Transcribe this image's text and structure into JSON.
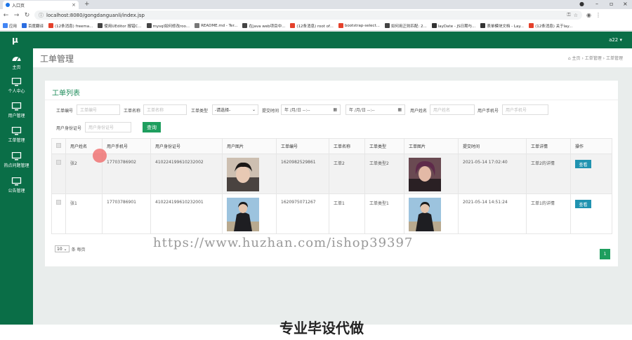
{
  "browser": {
    "tab_title": "入口页",
    "url": "localhost:8080/gongdanguanli/index.jsp",
    "bookmarks": [
      {
        "label": "应用",
        "color": "#4285f4"
      },
      {
        "label": "百度翻译",
        "color": "#2b6de0"
      },
      {
        "label": "(12条消息) freema...",
        "color": "#e4412b"
      },
      {
        "label": "使用UEditor 报错C...",
        "color": "#444444"
      },
      {
        "label": "mysql如何修改roo...",
        "color": "#444444"
      },
      {
        "label": "README.md - Ter...",
        "color": "#777777"
      },
      {
        "label": "在java web项目中...",
        "color": "#444444"
      },
      {
        "label": "(12条消息) root of...",
        "color": "#e4412b"
      },
      {
        "label": "bootstrap-select...",
        "color": "#e4412b"
      },
      {
        "label": "如何用正则匹配: 2...",
        "color": "#444444"
      },
      {
        "label": "layDate - JS日期与...",
        "color": "#333333"
      },
      {
        "label": "表单模块文档 - Lay...",
        "color": "#333333"
      },
      {
        "label": "(12条消息) 关于lay...",
        "color": "#e4412b"
      }
    ]
  },
  "app": {
    "logo": "μ",
    "user": "a22 ▾"
  },
  "sidebar": {
    "items": [
      {
        "label": "主页"
      },
      {
        "label": "个人中心"
      },
      {
        "label": "用户管理"
      },
      {
        "label": "工单管理"
      },
      {
        "label": "热点问题管理"
      },
      {
        "label": "公告管理"
      }
    ]
  },
  "page": {
    "title": "工单管理",
    "breadcrumb": "⌂ 主页 › 工单管理 › 工单管理"
  },
  "panel": {
    "title": "工单列表",
    "filters": {
      "order_no_label": "工单编号",
      "order_no_placeholder": "工单编号",
      "order_name_label": "工单名称",
      "order_name_placeholder": "工单名称",
      "order_type_label": "工单类型",
      "order_type_value": "-请选择-",
      "submit_time_label": "提交时间",
      "date_placeholder": "年 /月/日  --:--",
      "username_label": "用户姓名",
      "username_placeholder": "用户姓名",
      "phone_label": "用户手机号",
      "phone_placeholder": "用户手机号",
      "idcard_label": "用户身份证号",
      "idcard_placeholder": "用户身份证号",
      "search_button": "查询"
    },
    "table": {
      "headers": [
        "用户姓名",
        "用户手机号",
        "用户身份证号",
        "用户图片",
        "工单编号",
        "工单名称",
        "工单类型",
        "工单图片",
        "提交时间",
        "工单详情",
        "操作"
      ],
      "rows": [
        {
          "name": "张2",
          "phone": "17703786902",
          "idcard": "410224199610232002",
          "order_no": "1620982529861",
          "order_name": "工单2",
          "order_type": "工单类型2",
          "submit_time": "2021-05-14 17:02:40",
          "detail": "工单2的详情",
          "action": "查看"
        },
        {
          "name": "张1",
          "phone": "17703786901",
          "idcard": "410224199610232001",
          "order_no": "1620975071267",
          "order_name": "工单1",
          "order_type": "工单类型1",
          "submit_time": "2021-05-14 14:51:24",
          "detail": "工单1的详情",
          "action": "查看"
        }
      ]
    },
    "pagination": {
      "page_size": "10",
      "per_page_label": "条 每页",
      "current_page": "1"
    }
  },
  "overlay": {
    "watermark": "https://www.huzhan.com/ishop39397",
    "promo": "专业毕设代做"
  },
  "colors": {
    "brand_green": "#0a6e47",
    "accent_green": "#1e9e5e",
    "view_button": "#2093b0"
  }
}
